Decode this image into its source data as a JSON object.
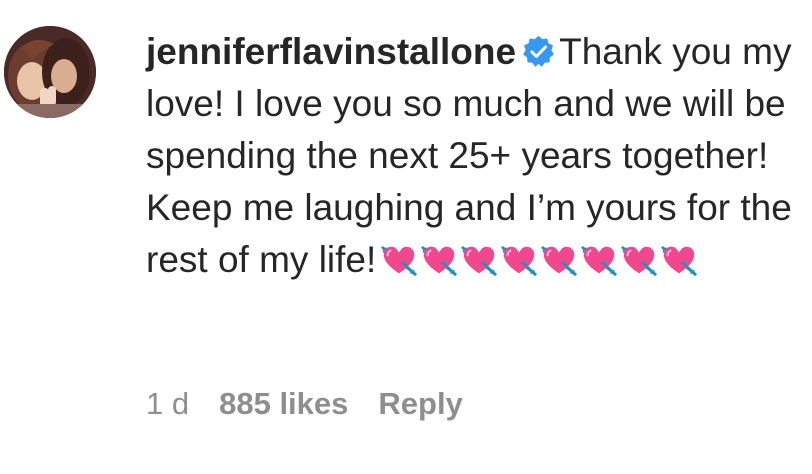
{
  "comment": {
    "username": "jenniferflavinstallone",
    "verified_icon": "verified-badge-icon",
    "text": "Thank you my love! I love you so much and we will be spending the next 25+ years together! Keep me laughing and I’m yours for the rest of my life!",
    "emoji_icon": "heart-with-arrow-icon",
    "emoji_count": 8
  },
  "footer": {
    "time": "1 d",
    "likes": "885 likes",
    "reply_label": "Reply"
  },
  "colors": {
    "text": "#262626",
    "secondary": "#8e8e8e",
    "verified": "#3897f0",
    "heart": "#f0478f",
    "arrow": "#2a8fbf"
  }
}
